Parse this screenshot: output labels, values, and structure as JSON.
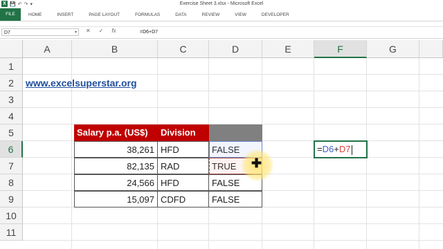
{
  "window_title": "Exercise Sheet 3.xlsx - Microsoft Excel",
  "quick_access": {
    "logo": "X",
    "save": "💾",
    "undo": "↶",
    "redo": "↷",
    "dropdown": "▾"
  },
  "ribbon": {
    "file": "FILE",
    "tabs": [
      "HOME",
      "INSERT",
      "PAGE LAYOUT",
      "FORMULAS",
      "DATA",
      "REVIEW",
      "VIEW",
      "DEVELOPER"
    ]
  },
  "formula_bar": {
    "name_box": "D7",
    "cancel": "✕",
    "enter": "✓",
    "fx": "fx",
    "content": "=D6+D7"
  },
  "columns": [
    "A",
    "B",
    "C",
    "D",
    "E",
    "F",
    "G"
  ],
  "rows": [
    "1",
    "2",
    "3",
    "4",
    "5",
    "6",
    "7",
    "8",
    "9",
    "10",
    "11"
  ],
  "cells": {
    "a2": "www.excelsuperstar.org",
    "b5": "Salary p.a. (US$)",
    "c5": "Division",
    "b6": "38,261",
    "c6": "HFD",
    "d6": "FALSE",
    "b7": "82,135",
    "c7": "RAD",
    "d7": "TRUE",
    "b8": "24,566",
    "c8": "HFD",
    "d8": "FALSE",
    "b9": "15,097",
    "c9": "CDFD",
    "d9": "FALSE",
    "f6": {
      "eq": "=",
      "ref1": "D6",
      "plus": "+",
      "ref2": "D7"
    }
  },
  "colors": {
    "excel_green": "#217346",
    "header_red": "#c00000",
    "ref_blue": "#3d62d1",
    "ref_red": "#d2453b"
  },
  "cursor_icon": "✚"
}
